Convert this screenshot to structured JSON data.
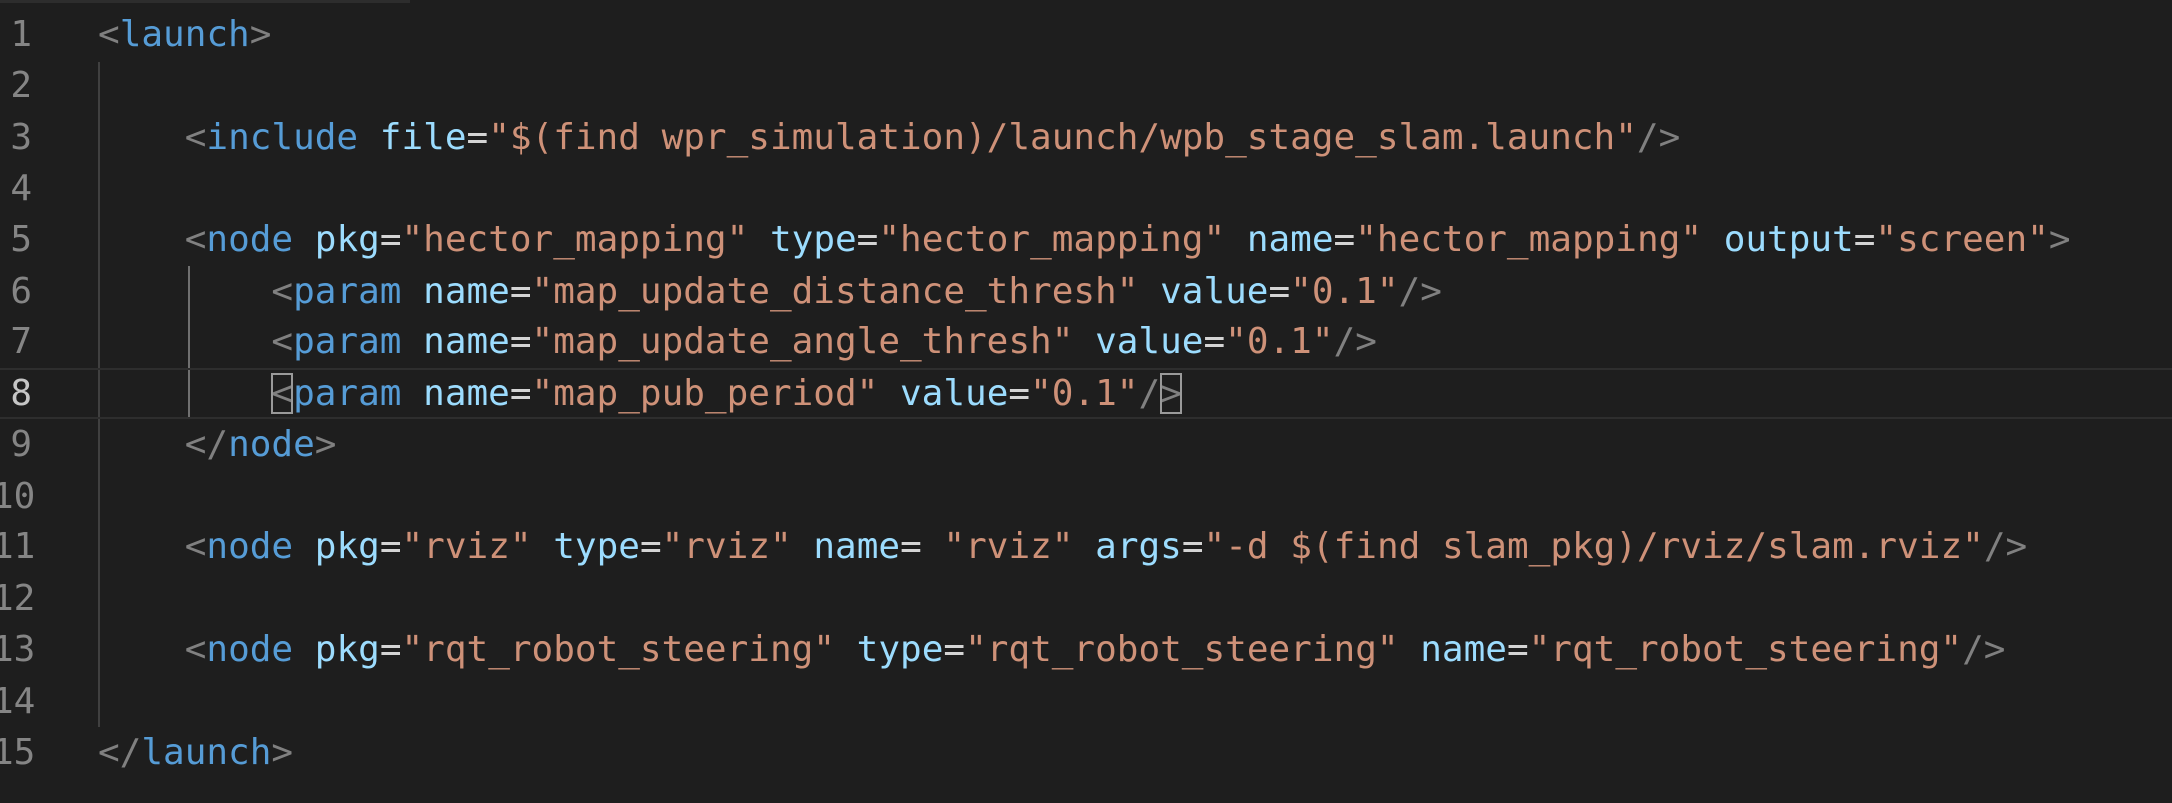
{
  "editor": {
    "lines": [
      {
        "num": "1",
        "tokens": [
          {
            "t": "t",
            "v": "<"
          },
          {
            "t": "n",
            "v": "launch"
          },
          {
            "t": "t",
            "v": ">"
          }
        ]
      },
      {
        "num": "2",
        "tokens": []
      },
      {
        "num": "3",
        "tokens": [
          {
            "t": "p",
            "v": "    "
          },
          {
            "t": "t",
            "v": "<"
          },
          {
            "t": "n",
            "v": "include"
          },
          {
            "t": "p",
            "v": " "
          },
          {
            "t": "a",
            "v": "file"
          },
          {
            "t": "p",
            "v": "="
          },
          {
            "t": "s",
            "v": "\"$(find wpr_simulation)/launch/wpb_stage_slam.launch\""
          },
          {
            "t": "t",
            "v": "/>"
          }
        ]
      },
      {
        "num": "4",
        "tokens": []
      },
      {
        "num": "5",
        "tokens": [
          {
            "t": "p",
            "v": "    "
          },
          {
            "t": "t",
            "v": "<"
          },
          {
            "t": "n",
            "v": "node"
          },
          {
            "t": "p",
            "v": " "
          },
          {
            "t": "a",
            "v": "pkg"
          },
          {
            "t": "p",
            "v": "="
          },
          {
            "t": "s",
            "v": "\"hector_mapping\""
          },
          {
            "t": "p",
            "v": " "
          },
          {
            "t": "a",
            "v": "type"
          },
          {
            "t": "p",
            "v": "="
          },
          {
            "t": "s",
            "v": "\"hector_mapping\""
          },
          {
            "t": "p",
            "v": " "
          },
          {
            "t": "a",
            "v": "name"
          },
          {
            "t": "p",
            "v": "="
          },
          {
            "t": "s",
            "v": "\"hector_mapping\""
          },
          {
            "t": "p",
            "v": " "
          },
          {
            "t": "a",
            "v": "output"
          },
          {
            "t": "p",
            "v": "="
          },
          {
            "t": "s",
            "v": "\"screen\""
          },
          {
            "t": "t",
            "v": ">"
          }
        ]
      },
      {
        "num": "6",
        "tokens": [
          {
            "t": "p",
            "v": "        "
          },
          {
            "t": "t",
            "v": "<"
          },
          {
            "t": "n",
            "v": "param"
          },
          {
            "t": "p",
            "v": " "
          },
          {
            "t": "a",
            "v": "name"
          },
          {
            "t": "p",
            "v": "="
          },
          {
            "t": "s",
            "v": "\"map_update_distance_thresh\""
          },
          {
            "t": "p",
            "v": " "
          },
          {
            "t": "a",
            "v": "value"
          },
          {
            "t": "p",
            "v": "="
          },
          {
            "t": "s",
            "v": "\"0.1\""
          },
          {
            "t": "t",
            "v": "/>"
          }
        ]
      },
      {
        "num": "7",
        "tokens": [
          {
            "t": "p",
            "v": "        "
          },
          {
            "t": "t",
            "v": "<"
          },
          {
            "t": "n",
            "v": "param"
          },
          {
            "t": "p",
            "v": " "
          },
          {
            "t": "a",
            "v": "name"
          },
          {
            "t": "p",
            "v": "="
          },
          {
            "t": "s",
            "v": "\"map_update_angle_thresh\""
          },
          {
            "t": "p",
            "v": " "
          },
          {
            "t": "a",
            "v": "value"
          },
          {
            "t": "p",
            "v": "="
          },
          {
            "t": "s",
            "v": "\"0.1\""
          },
          {
            "t": "t",
            "v": "/>"
          }
        ]
      },
      {
        "num": "8",
        "tokens": [
          {
            "t": "p",
            "v": "        "
          },
          {
            "t": "t bm",
            "v": "<"
          },
          {
            "t": "n",
            "v": "param"
          },
          {
            "t": "p",
            "v": " "
          },
          {
            "t": "a",
            "v": "name"
          },
          {
            "t": "p",
            "v": "="
          },
          {
            "t": "s",
            "v": "\"map_pub_period\""
          },
          {
            "t": "p",
            "v": " "
          },
          {
            "t": "a",
            "v": "value"
          },
          {
            "t": "p",
            "v": "="
          },
          {
            "t": "s",
            "v": "\"0.1\""
          },
          {
            "t": "t",
            "v": "/"
          },
          {
            "t": "t bm",
            "v": ">"
          }
        ]
      },
      {
        "num": "9",
        "tokens": [
          {
            "t": "p",
            "v": "    "
          },
          {
            "t": "t",
            "v": "</"
          },
          {
            "t": "n",
            "v": "node"
          },
          {
            "t": "t",
            "v": ">"
          }
        ]
      },
      {
        "num": "10",
        "tokens": []
      },
      {
        "num": "11",
        "tokens": [
          {
            "t": "p",
            "v": "    "
          },
          {
            "t": "t",
            "v": "<"
          },
          {
            "t": "n",
            "v": "node"
          },
          {
            "t": "p",
            "v": " "
          },
          {
            "t": "a",
            "v": "pkg"
          },
          {
            "t": "p",
            "v": "="
          },
          {
            "t": "s",
            "v": "\"rviz\""
          },
          {
            "t": "p",
            "v": " "
          },
          {
            "t": "a",
            "v": "type"
          },
          {
            "t": "p",
            "v": "="
          },
          {
            "t": "s",
            "v": "\"rviz\""
          },
          {
            "t": "p",
            "v": " "
          },
          {
            "t": "a",
            "v": "name"
          },
          {
            "t": "p",
            "v": "= "
          },
          {
            "t": "s",
            "v": "\"rviz\""
          },
          {
            "t": "p",
            "v": " "
          },
          {
            "t": "a",
            "v": "args"
          },
          {
            "t": "p",
            "v": "="
          },
          {
            "t": "s",
            "v": "\"-d $(find slam_pkg)/rviz/slam.rviz\""
          },
          {
            "t": "t",
            "v": "/>"
          }
        ]
      },
      {
        "num": "12",
        "tokens": []
      },
      {
        "num": "13",
        "tokens": [
          {
            "t": "p",
            "v": "    "
          },
          {
            "t": "t",
            "v": "<"
          },
          {
            "t": "n",
            "v": "node"
          },
          {
            "t": "p",
            "v": " "
          },
          {
            "t": "a",
            "v": "pkg"
          },
          {
            "t": "p",
            "v": "="
          },
          {
            "t": "s",
            "v": "\"rqt_robot_steering\""
          },
          {
            "t": "p",
            "v": " "
          },
          {
            "t": "a",
            "v": "type"
          },
          {
            "t": "p",
            "v": "="
          },
          {
            "t": "s",
            "v": "\"rqt_robot_steering\""
          },
          {
            "t": "p",
            "v": " "
          },
          {
            "t": "a",
            "v": "name"
          },
          {
            "t": "p",
            "v": "="
          },
          {
            "t": "s",
            "v": "\"rqt_robot_steering\""
          },
          {
            "t": "t",
            "v": "/>"
          }
        ]
      },
      {
        "num": "14",
        "tokens": []
      },
      {
        "num": "15",
        "tokens": [
          {
            "t": "t",
            "v": "</"
          },
          {
            "t": "n",
            "v": "launch"
          },
          {
            "t": "t",
            "v": ">"
          }
        ]
      }
    ],
    "current_line": 8
  },
  "colors": {
    "background": "#1e1e1e",
    "tag_bracket": "#808080",
    "tag_name": "#569cd6",
    "attribute": "#9cdcfe",
    "string": "#ce9178",
    "line_number": "#858585"
  }
}
